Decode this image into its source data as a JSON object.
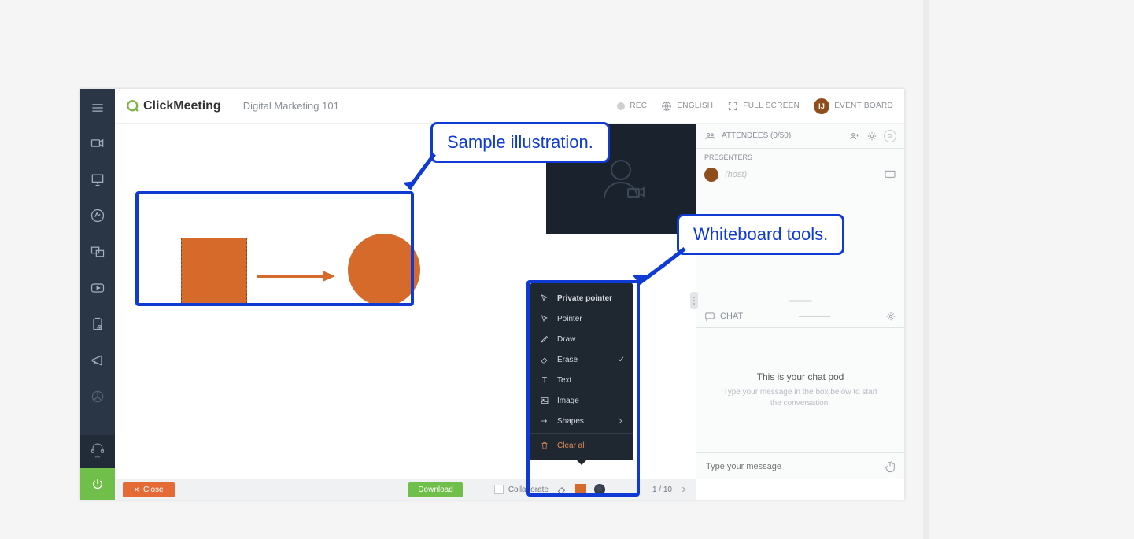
{
  "brand": "ClickMeeting",
  "meeting_title": "Digital Marketing 101",
  "header": {
    "rec": "REC",
    "language": "ENGLISH",
    "fullscreen": "FULL SCREEN",
    "avatar_initials": "IJ",
    "event_board": "EVENT BOARD"
  },
  "attendees": {
    "label": "ATTENDEES (0/50)",
    "presenters_label": "PRESENTERS",
    "host_label": "(host)"
  },
  "chat": {
    "label": "CHAT",
    "pod_title": "This is your chat pod",
    "pod_sub": "Type your message in the box below to start the conversation.",
    "input_placeholder": "Type your message"
  },
  "bottom": {
    "close": "Close",
    "download": "Download",
    "collaborate": "Collaborate",
    "page": "1 / 10"
  },
  "wb_tools": {
    "private_pointer": "Private pointer",
    "pointer": "Pointer",
    "draw": "Draw",
    "erase": "Erase",
    "text": "Text",
    "image": "Image",
    "shapes": "Shapes",
    "clear_all": "Clear all"
  },
  "annotations": {
    "sample": "Sample illustration.",
    "tools": "Whiteboard tools."
  }
}
